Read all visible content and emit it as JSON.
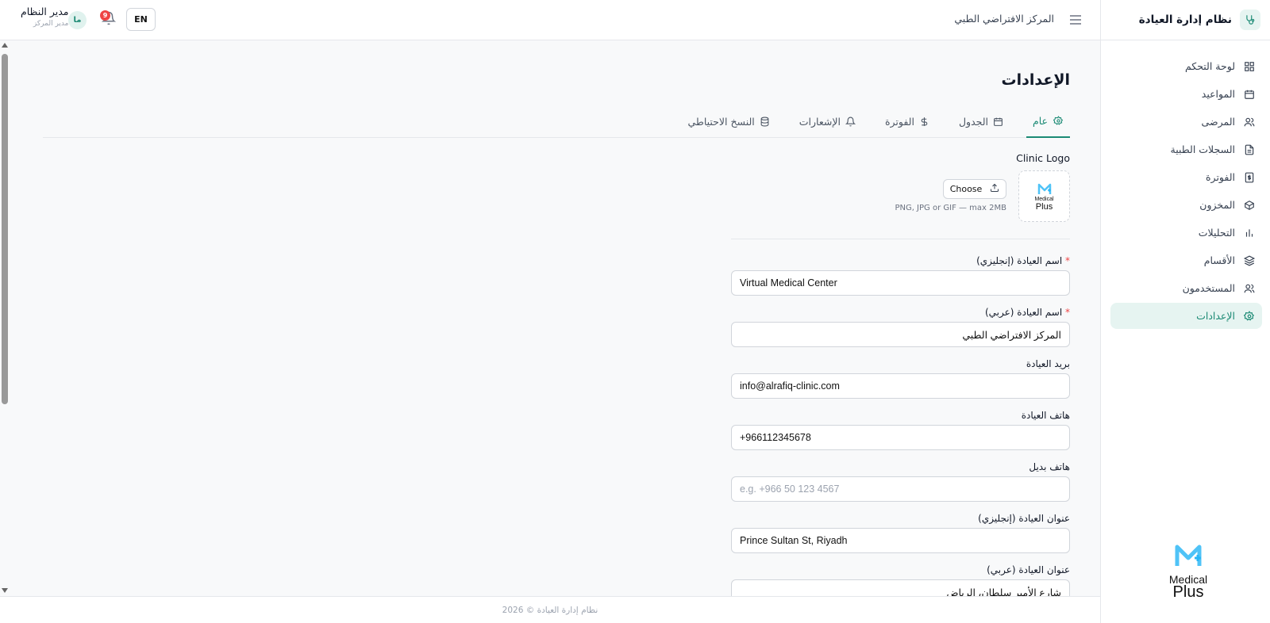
{
  "sidebar": {
    "brand_title": "نظام إدارة العيادة",
    "items": [
      {
        "label": "لوحة التحكم",
        "icon": "dashboard-icon"
      },
      {
        "label": "المواعيد",
        "icon": "calendar-icon"
      },
      {
        "label": "المرضى",
        "icon": "users-icon"
      },
      {
        "label": "السجلات الطبية",
        "icon": "file-icon"
      },
      {
        "label": "الفوترة",
        "icon": "receipt-icon"
      },
      {
        "label": "المخزون",
        "icon": "box-icon"
      },
      {
        "label": "التحليلات",
        "icon": "bar-chart-icon"
      },
      {
        "label": "الأقسام",
        "icon": "layers-icon"
      },
      {
        "label": "المستخدمون",
        "icon": "users-icon"
      },
      {
        "label": "الإعدادات",
        "icon": "gear-icon",
        "active": true
      }
    ],
    "logo_line1": "Medical",
    "logo_line2": "Plus"
  },
  "header": {
    "clinic_name": "المركز الافتراضي الطبي",
    "user_name": "مدير النظام",
    "user_role": "مدير المركز",
    "avatar_initials": "ما",
    "notification_count": "9",
    "language_toggle": "EN"
  },
  "page": {
    "title": "الإعدادات",
    "tabs": [
      {
        "label": "عام",
        "icon": "gear-icon",
        "active": true
      },
      {
        "label": "الجدول",
        "icon": "calendar-icon"
      },
      {
        "label": "الفوترة",
        "icon": "dollar-icon"
      },
      {
        "label": "الإشعارات",
        "icon": "bell-icon"
      },
      {
        "label": "النسخ الاحتياطي",
        "icon": "database-icon"
      }
    ]
  },
  "form": {
    "logo_label": "Clinic Logo",
    "choose_label": "Choose",
    "logo_hint": "PNG, JPG or GIF — max 2MB",
    "logo_line1": "Medical",
    "logo_line2": "Plus",
    "clinic_name_en": {
      "label": "اسم العيادة (إنجليزي)",
      "required": "*",
      "value": "Virtual Medical Center"
    },
    "clinic_name_ar": {
      "label": "اسم العيادة (عربي)",
      "required": "*",
      "value": "المركز الافتراضي الطبي"
    },
    "clinic_email": {
      "label": "بريد العيادة",
      "value": "info@alrafiq-clinic.com"
    },
    "clinic_phone": {
      "label": "هاتف العيادة",
      "value": "+966112345678"
    },
    "alt_phone": {
      "label": "هاتف بديل",
      "placeholder": "e.g. +966 50 123 4567"
    },
    "address_en": {
      "label": "عنوان العيادة (إنجليزي)",
      "value": "Prince Sultan St, Riyadh"
    },
    "address_ar": {
      "label": "عنوان العيادة (عربي)",
      "value": "شارع الأمير سلطان، الرياض"
    }
  },
  "footer": {
    "text": "نظام إدارة العيادة © 2026"
  },
  "colors": {
    "accent": "#1b8a74",
    "accent_bg": "#e6f4f1",
    "danger": "#ef4444"
  }
}
